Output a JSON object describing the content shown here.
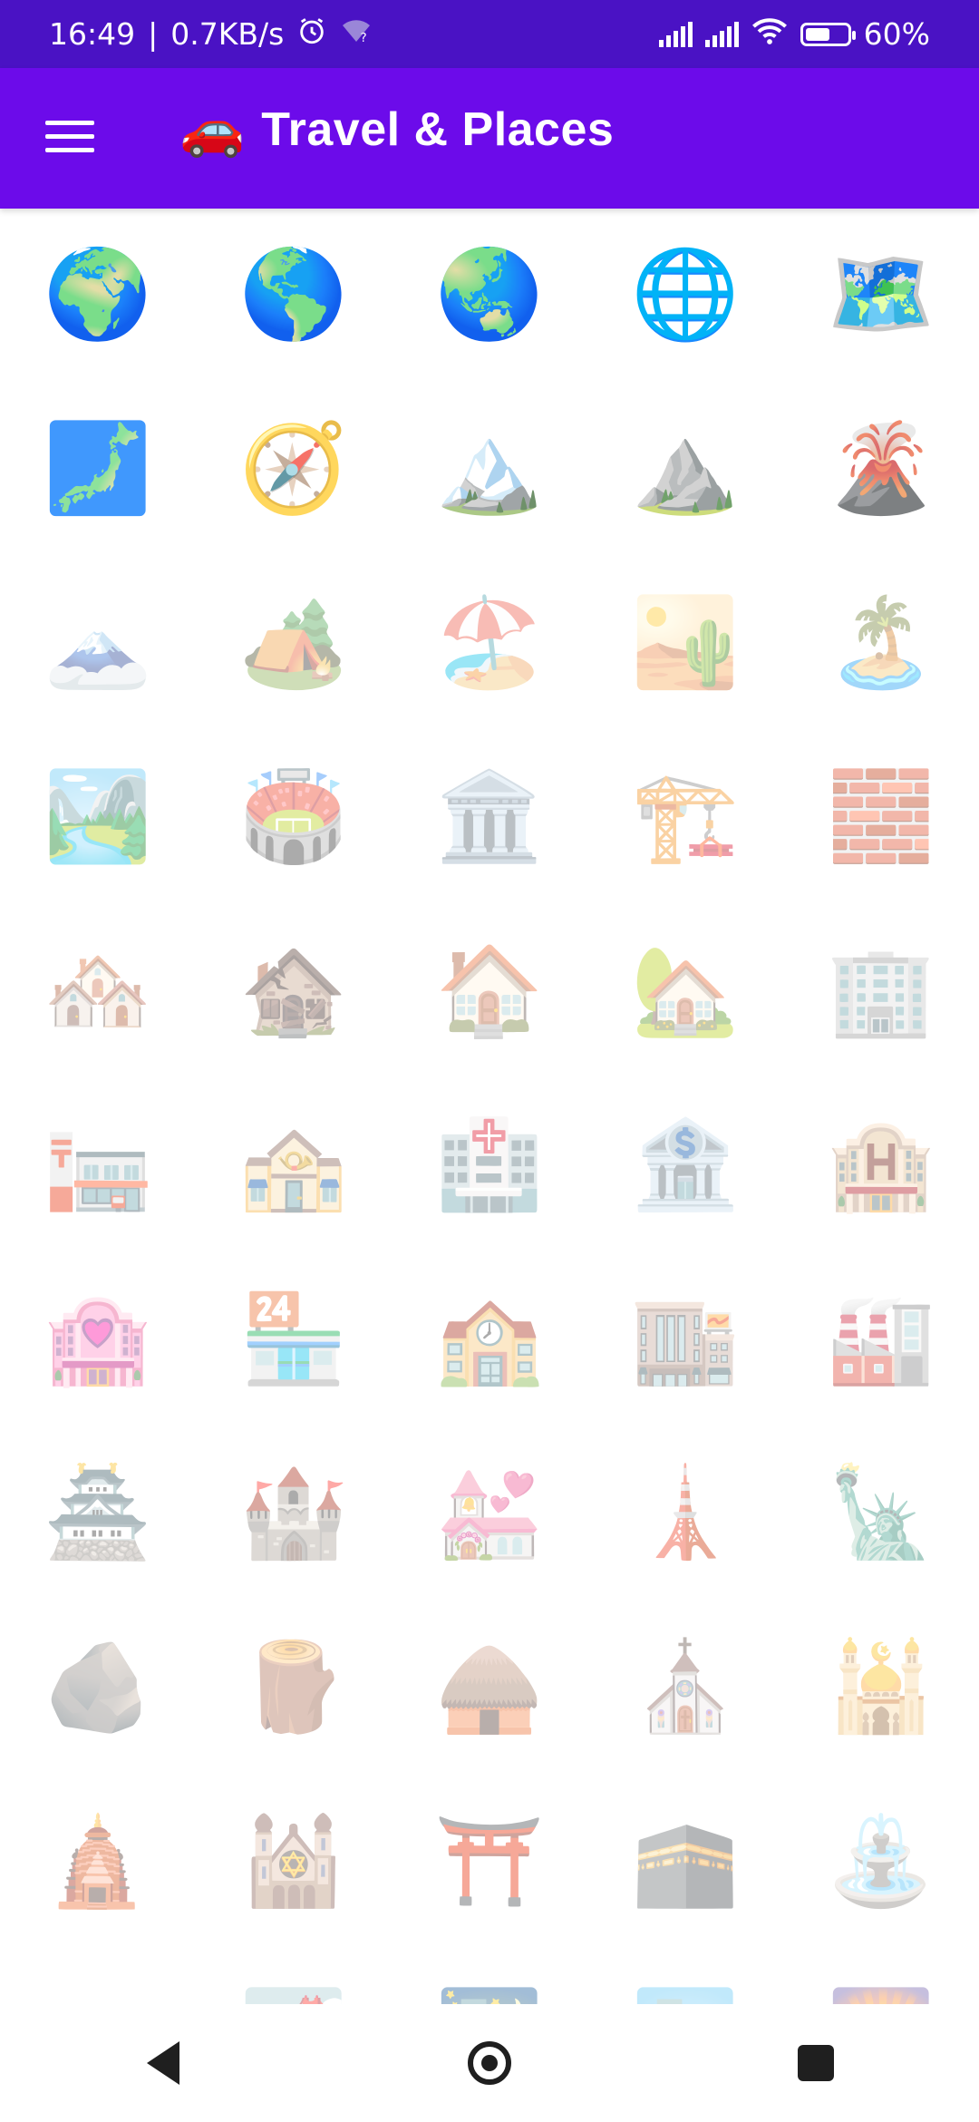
{
  "status_bar": {
    "time": "16:49",
    "net_speed": "0.7KB/s",
    "battery_percent": "60%",
    "battery_level": 0.6
  },
  "app_bar": {
    "title_emoji": "🚗",
    "title": "Travel & Places"
  },
  "emojis": [
    "🌍",
    "🌎",
    "🌏",
    "🌐",
    "🗺️",
    "🗾",
    "🧭",
    "🏔️",
    "⛰️",
    "🌋",
    "🗻",
    "🏕️",
    "🏖️",
    "🏜️",
    "🏝️",
    "🏞️",
    "🏟️",
    "🏛️",
    "🏗️",
    "🧱",
    "🏘️",
    "🏚️",
    "🏠",
    "🏡",
    "🏢",
    "🏣",
    "🏤",
    "🏥",
    "🏦",
    "🏨",
    "🏩",
    "🏪",
    "🏫",
    "🏬",
    "🏭",
    "🏯",
    "🏰",
    "💒",
    "🗼",
    "🗽",
    "🪨",
    "🪵",
    "🛖",
    "⛪",
    "🕌",
    "🛕",
    "🕍",
    "⛩️",
    "🕋",
    "⛲",
    "⛺",
    "🌁",
    "🌃",
    "🏙️",
    "🌄"
  ],
  "icons": {
    "alarm": "alarm-icon",
    "wifi": "wifi-icon",
    "signal": "signal-icon",
    "battery": "battery-icon",
    "menu": "menu-icon",
    "back": "back-icon",
    "home": "home-icon",
    "recents": "recents-icon"
  }
}
